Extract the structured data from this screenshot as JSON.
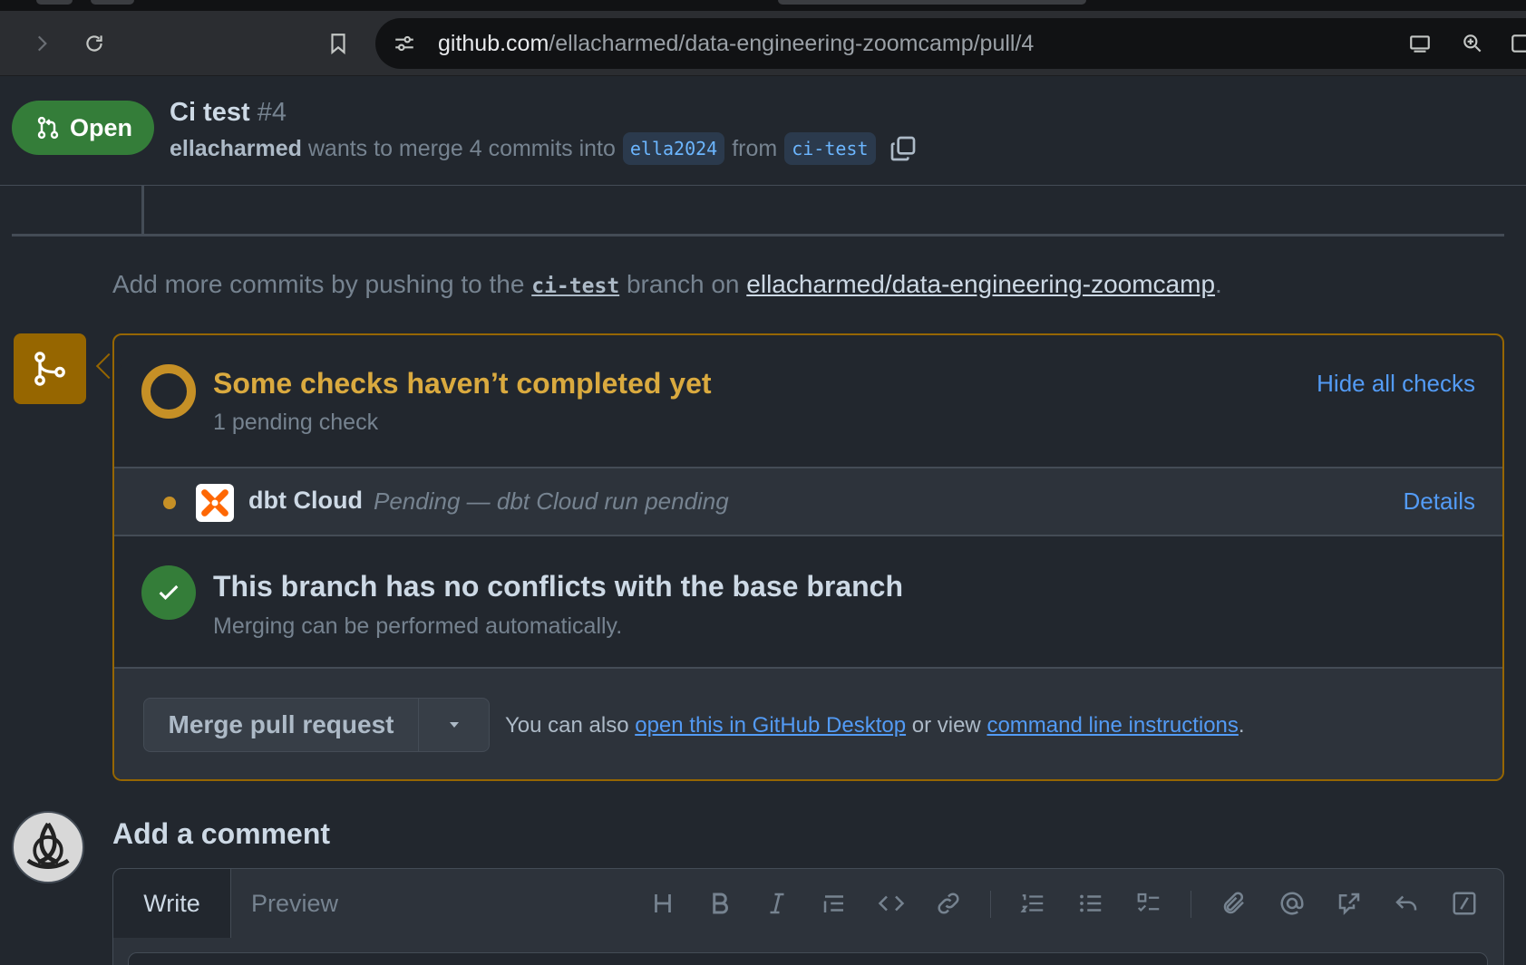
{
  "browser": {
    "url_host": "github.com",
    "url_path": "/ellacharmed/data-engineering-zoomcamp/pull/4",
    "icons": [
      "forward-icon",
      "reload-icon",
      "bookmark-icon",
      "site-settings-icon",
      "install-app-icon",
      "zoom-icon",
      "sidebar-icon"
    ]
  },
  "pr": {
    "state_label": "Open",
    "title": "Ci test",
    "number": "#4",
    "author": "ellacharmed",
    "merge_text": "wants to merge 4 commits into",
    "base_branch": "ella2024",
    "from_text": "from",
    "head_branch": "ci-test"
  },
  "push_hint": {
    "prefix": "Add more commits by pushing to the",
    "branch": "ci-test",
    "middle": "branch on",
    "repo": "ellacharmed/data-engineering-zoomcamp",
    "suffix": "."
  },
  "checks": {
    "title": "Some checks haven’t completed yet",
    "subtitle": "1 pending check",
    "hide_label": "Hide all checks",
    "items": [
      {
        "name": "dbt Cloud",
        "status": "Pending — dbt Cloud run pending",
        "details_label": "Details"
      }
    ]
  },
  "conflicts": {
    "title": "This branch has no conflicts with the base branch",
    "subtitle": "Merging can be performed automatically."
  },
  "merge": {
    "button_label": "Merge pull request",
    "alt_prefix": "You can also",
    "desktop_link": "open this in GitHub Desktop",
    "alt_middle": "or view",
    "cli_link": "command line instructions",
    "alt_suffix": "."
  },
  "comment": {
    "heading": "Add a comment",
    "tab_write": "Write",
    "tab_preview": "Preview"
  },
  "colors": {
    "open_green": "#347d39",
    "pending_yellow": "#c69026",
    "link_blue": "#539bf5",
    "background": "#22272e"
  }
}
